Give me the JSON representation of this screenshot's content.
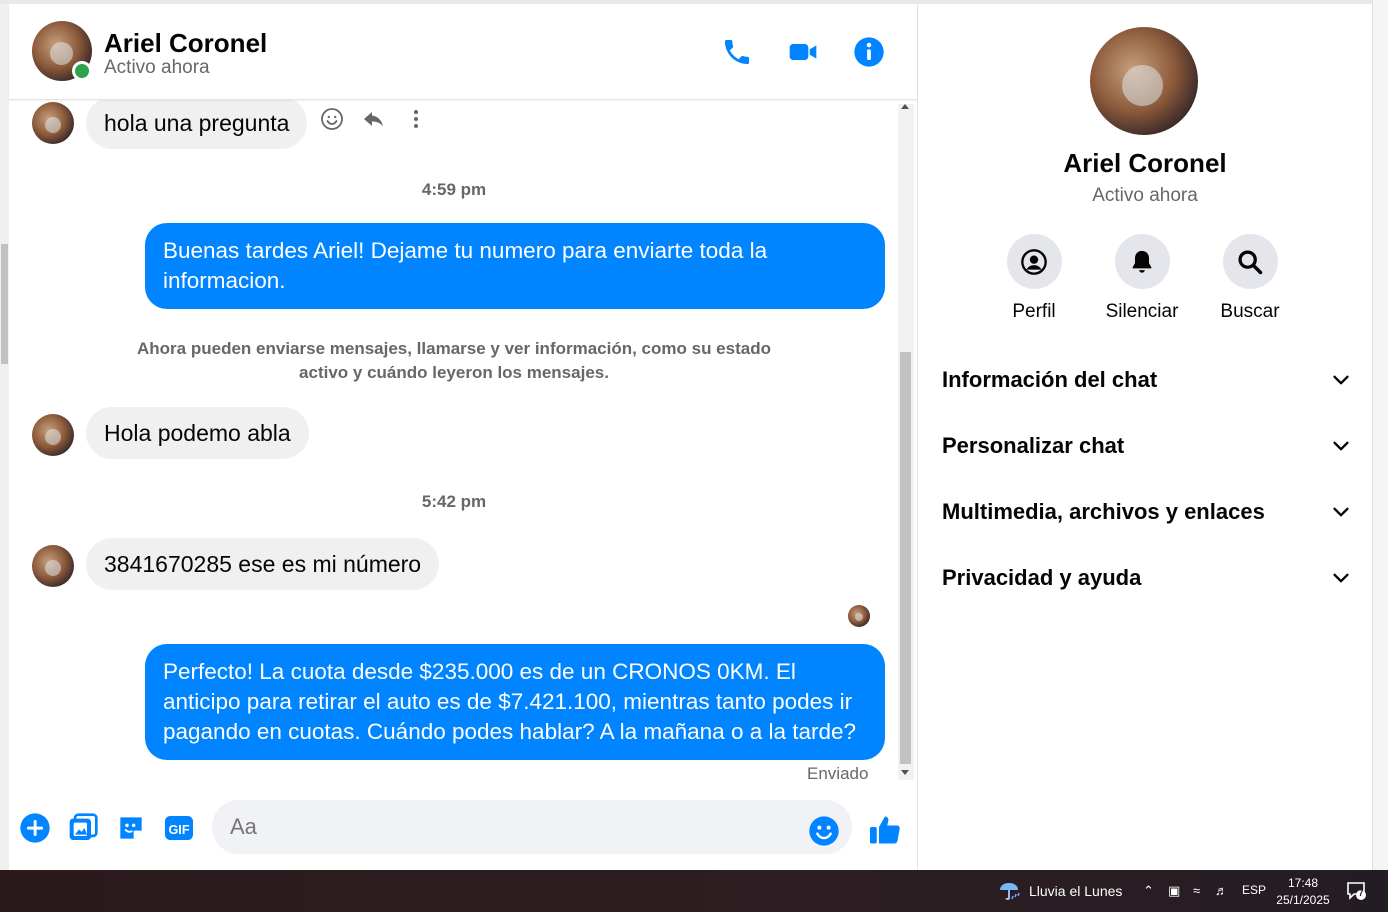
{
  "header": {
    "name": "Ariel Coronel",
    "status": "Activo ahora"
  },
  "messages": {
    "m1": "hola una pregunta",
    "t1": "4:59 pm",
    "m2": "Buenas tardes Ariel! Dejame tu numero para enviarte toda la informacion.",
    "system_note": "Ahora pueden enviarse mensajes, llamarse y ver información, como su estado activo y cuándo leyeron los mensajes.",
    "m3": "Hola podemo abla",
    "t2": "5:42 pm",
    "m4": "3841670285 ese es mi número",
    "m5": "Perfecto! La cuota desde $235.000 es de un CRONOS 0KM. El anticipo para retirar el auto es de $7.421.100, mientras tanto podes ir pagando en cuotas. Cuándo podes hablar? A la mañana o a la tarde?",
    "sent": "Enviado"
  },
  "composer": {
    "placeholder": "Aa"
  },
  "info": {
    "name": "Ariel Coronel",
    "status": "Activo ahora",
    "actions": [
      "Perfil",
      "Silenciar",
      "Buscar"
    ],
    "sections": [
      "Información del chat",
      "Personalizar chat",
      "Multimedia, archivos y enlaces",
      "Privacidad y ayuda"
    ]
  },
  "taskbar": {
    "weather": "Lluvia el Lunes",
    "lang": "ESP",
    "time": "17:48",
    "date": "25/1/2025",
    "notifications": "7"
  },
  "colors": {
    "accent": "#0084ff",
    "online": "#31a24c",
    "incoming_bubble": "#f0f0f0"
  },
  "icons": [
    "phone-icon",
    "video-icon",
    "info-icon",
    "emoji-react-icon",
    "reply-icon",
    "more-icon",
    "plus-icon",
    "gallery-icon",
    "sticker-icon",
    "gif-icon",
    "emoji-icon",
    "like-icon",
    "profile-icon",
    "bell-icon",
    "search-icon",
    "chevron-down-icon",
    "weather-icon",
    "notification-icon"
  ]
}
